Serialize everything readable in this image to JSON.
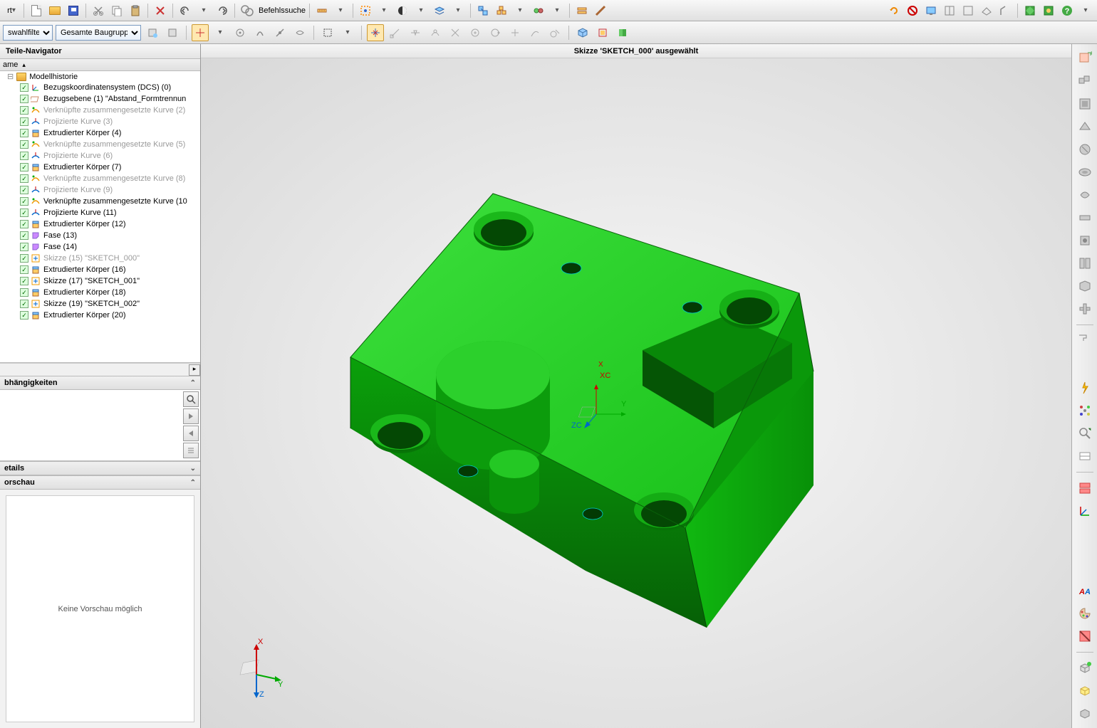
{
  "toolbar": {
    "cmd_search_label": "Befehlssuche"
  },
  "filter_row": {
    "type_filter_partial": "swahlfilter",
    "assembly_filter": "Gesamte Baugrupp"
  },
  "status_bar": "Skizze 'SKETCH_000' ausgewählt",
  "left_panel": {
    "title": "Teile-Navigator",
    "column_header": "ame",
    "root_label": "Modellhistorie",
    "tree_items": [
      {
        "label": "Bezugskoordinatensystem (DCS) (0)",
        "disabled": false,
        "icon": "csys"
      },
      {
        "label": "Bezugsebene (1) \"Abstand_Formtrennun",
        "disabled": false,
        "icon": "plane"
      },
      {
        "label": "Verknüpfte zusammengesetzte Kurve (2)",
        "disabled": true,
        "icon": "curve"
      },
      {
        "label": "Projizierte Kurve (3)",
        "disabled": true,
        "icon": "proj"
      },
      {
        "label": "Extrudierter Körper (4)",
        "disabled": false,
        "icon": "extrude"
      },
      {
        "label": "Verknüpfte zusammengesetzte Kurve (5)",
        "disabled": true,
        "icon": "curve"
      },
      {
        "label": "Projizierte Kurve (6)",
        "disabled": true,
        "icon": "proj"
      },
      {
        "label": "Extrudierter Körper (7)",
        "disabled": false,
        "icon": "extrude"
      },
      {
        "label": "Verknüpfte zusammengesetzte Kurve (8)",
        "disabled": true,
        "icon": "curve"
      },
      {
        "label": "Projizierte Kurve (9)",
        "disabled": true,
        "icon": "proj"
      },
      {
        "label": "Verknüpfte zusammengesetzte Kurve (10",
        "disabled": false,
        "icon": "curve"
      },
      {
        "label": "Projizierte Kurve (11)",
        "disabled": false,
        "icon": "proj"
      },
      {
        "label": "Extrudierter Körper (12)",
        "disabled": false,
        "icon": "extrude"
      },
      {
        "label": "Fase (13)",
        "disabled": false,
        "icon": "chamfer"
      },
      {
        "label": "Fase (14)",
        "disabled": false,
        "icon": "chamfer"
      },
      {
        "label": "Skizze (15) \"SKETCH_000\"",
        "disabled": true,
        "icon": "sketch"
      },
      {
        "label": "Extrudierter Körper (16)",
        "disabled": false,
        "icon": "extrude"
      },
      {
        "label": "Skizze (17) \"SKETCH_001\"",
        "disabled": false,
        "icon": "sketch"
      },
      {
        "label": "Extrudierter Körper (18)",
        "disabled": false,
        "icon": "extrude"
      },
      {
        "label": "Skizze (19) \"SKETCH_002\"",
        "disabled": false,
        "icon": "sketch"
      },
      {
        "label": "Extrudierter Körper (20)",
        "disabled": false,
        "icon": "extrude"
      }
    ],
    "dependencies_header": "bhängigkeiten",
    "details_header": "etails",
    "preview_header": "orschau",
    "preview_empty": "Keine Vorschau möglich"
  },
  "viewport": {
    "wcs": {
      "x": "XC",
      "y": "Y",
      "z": "ZC",
      "xaxis": "X"
    }
  }
}
